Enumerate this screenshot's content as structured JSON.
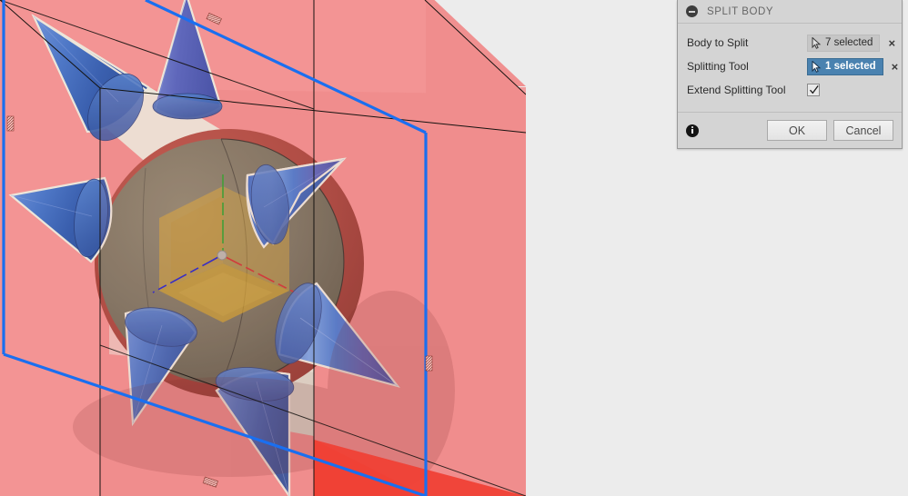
{
  "app": {
    "background_color": "#ececec",
    "viewport_bg": "#ececec"
  },
  "dialog": {
    "title": "SPLIT BODY",
    "collapse_icon": "minus-circle-icon",
    "rows": [
      {
        "label": "Body to Split",
        "value": "7 selected",
        "state": "inactive",
        "icon": "selection-cursor-icon",
        "clear": "×"
      },
      {
        "label": "Splitting Tool",
        "value": "1 selected",
        "state": "active",
        "icon": "selection-cursor-icon",
        "clear": "×"
      }
    ],
    "checkbox_row": {
      "label": "Extend Splitting Tool",
      "checked": true,
      "icon": "checkmark-icon"
    },
    "footer": {
      "info_icon": "info-icon",
      "ok_label": "OK",
      "cancel_label": "Cancel"
    },
    "colors": {
      "panel": "#d4d4d4",
      "active_field": "#4a82b0",
      "inactive_field": "#c6c6c6",
      "title_text": "#666666"
    }
  },
  "viewport": {
    "scene_name": "cad-3d-model-view",
    "objects": [
      {
        "name": "bounding-box-body",
        "color": "#f19191",
        "type": "translucent-box"
      },
      {
        "name": "highlighted-face-top-left",
        "color": "#ef4136",
        "type": "face"
      },
      {
        "name": "highlighted-face-bottom-right",
        "color": "#ef4136",
        "type": "face"
      },
      {
        "name": "sphere-body",
        "color": "#7c7561",
        "type": "sphere"
      },
      {
        "name": "sphere-red-shell",
        "color": "#a8453c",
        "type": "sphere-shell"
      },
      {
        "name": "cone-1",
        "color": "#4a6fc0",
        "type": "cone"
      },
      {
        "name": "cone-2",
        "color": "#5a5fb4",
        "type": "cone"
      },
      {
        "name": "cone-3",
        "color": "#4a6fc0",
        "type": "cone"
      },
      {
        "name": "cone-4",
        "color": "#4a77c4",
        "type": "cone"
      },
      {
        "name": "cone-5",
        "color": "#4a77c4",
        "type": "cone"
      },
      {
        "name": "cone-6",
        "color": "#4a6fc0",
        "type": "cone"
      },
      {
        "name": "cone-7",
        "color": "#4a6fc0",
        "type": "cone"
      },
      {
        "name": "origin-plane-xy",
        "color": "#d8a93a",
        "type": "plane"
      },
      {
        "name": "origin-plane-yz",
        "color": "#d8a93a",
        "type": "plane"
      },
      {
        "name": "origin-plane-xz",
        "color": "#d8a93a",
        "type": "plane"
      },
      {
        "name": "axis-x",
        "color": "#cc3333",
        "type": "axis-line"
      },
      {
        "name": "axis-y",
        "color": "#2fa02f",
        "type": "axis-line"
      },
      {
        "name": "axis-z",
        "color": "#2222cc",
        "type": "axis-line"
      },
      {
        "name": "origin-point",
        "color": "#b8b4ad",
        "type": "point"
      },
      {
        "name": "selected-edge-highlight",
        "color": "#1a6ff0",
        "type": "edge"
      }
    ],
    "edge_markers": 4
  }
}
